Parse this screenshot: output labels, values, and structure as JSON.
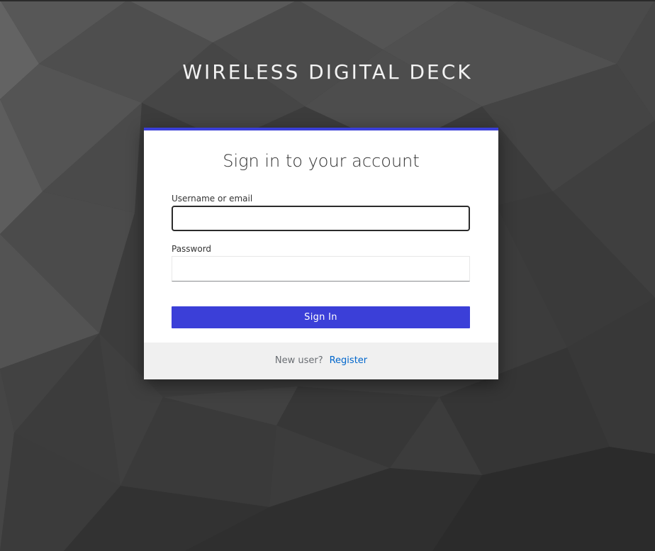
{
  "header": {
    "realm_title": "WIRELESS DIGITAL DECK"
  },
  "login": {
    "title": "Sign in to your account",
    "username_label": "Username or email",
    "username_value": "",
    "password_label": "Password",
    "password_value": "",
    "submit_label": "Sign In"
  },
  "footer": {
    "new_user_text": "New user?",
    "register_link": "Register"
  },
  "colors": {
    "accent": "#3b3fd8",
    "link": "#0066cc",
    "background": "#3a3a3a",
    "footer_bg": "#f0f0f0"
  }
}
